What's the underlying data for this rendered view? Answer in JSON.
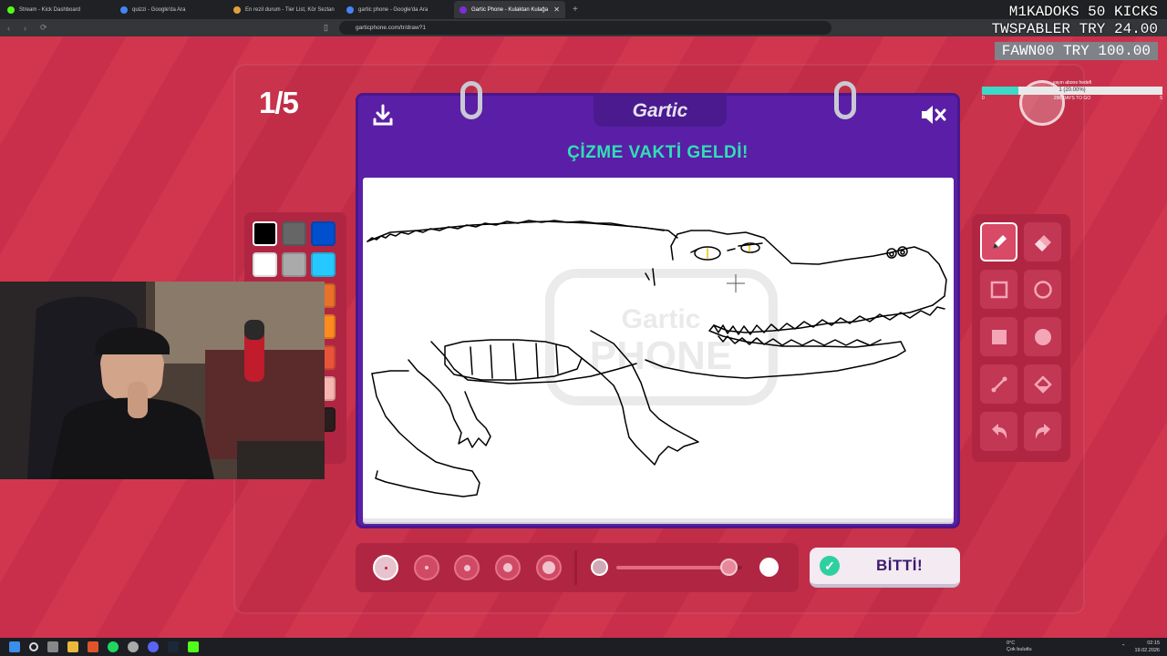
{
  "browser": {
    "tabs": [
      {
        "label": "Stream - Kick Dashboard",
        "color": "#53fc18",
        "active": false
      },
      {
        "label": "quizzi - Google'da Ara",
        "color": "#4285f4",
        "active": false
      },
      {
        "label": "En rezil durum - Tier List, Kör Sezlan",
        "color": "#e0a040",
        "active": false
      },
      {
        "label": "gartic phone - Google'da Ara",
        "color": "#4285f4",
        "active": false
      },
      {
        "label": "Gartic Phone - Kulaktan Kulağa",
        "color": "#7b2fd6",
        "active": true
      }
    ],
    "new_tab": "+",
    "url": "garticphone.com/tr/draw?1"
  },
  "game": {
    "round": "1/5",
    "logo": "Gartic",
    "heading": "ÇİZME VAKTİ GELDİ!",
    "done_label": "BİTTİ!",
    "watermark": "Gartic Phone",
    "palette": [
      "#000000",
      "#666666",
      "#0050cd",
      "#ffffff",
      "#aaaaaa",
      "#26c9ff",
      "#e8712a",
      "#ff8a1f",
      "#e8543a",
      "#f7b4b0",
      "#2b1d1d"
    ],
    "tools": [
      "pencil-icon",
      "eraser-icon",
      "square-outline-icon",
      "circle-outline-icon",
      "square-fill-icon",
      "circle-fill-icon",
      "line-icon",
      "bucket-icon",
      "undo-icon",
      "redo-icon"
    ],
    "selected_tool": "pencil-icon",
    "brush_sizes": 5,
    "selected_brush": 0,
    "opacity_level": 0.9
  },
  "stream_overlay": {
    "line1": "M1KADOKS  50 KICKS",
    "line2": "TWSPABLER  TRY 24.00",
    "line3": "FAWN00  TRY 100.00",
    "goal_title": "yayın abone hedefi",
    "goal_text": "1 (20.00%)",
    "goal_progress": 0.2,
    "goal_sub": "296 DAYS TO GO",
    "goal_min": "0",
    "goal_max": "5"
  },
  "taskbar": {
    "weather_temp": "0°C",
    "weather_desc": "Çok bulutlu",
    "time": "02:15",
    "date": "19.02.2026"
  }
}
